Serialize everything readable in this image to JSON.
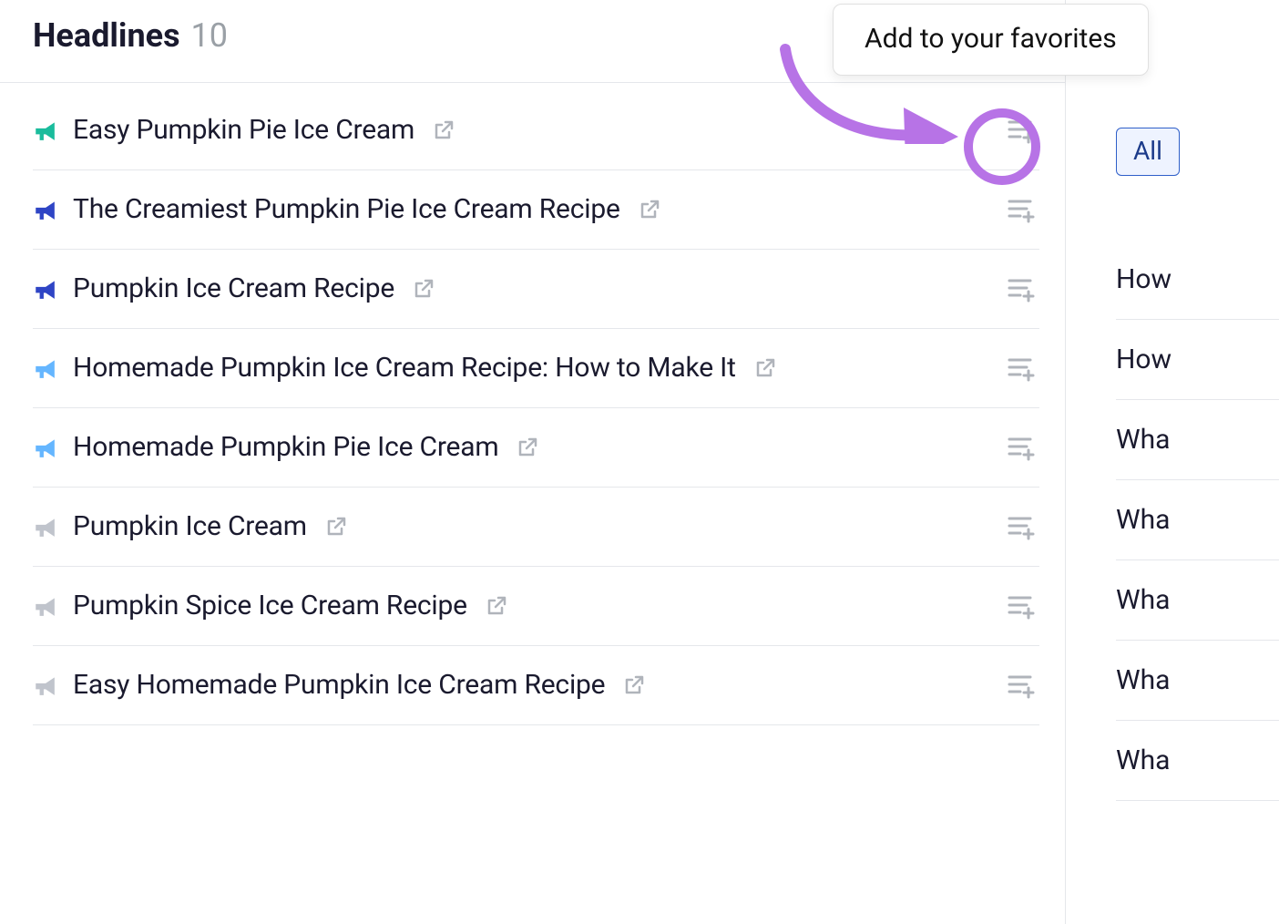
{
  "header": {
    "title": "Headlines",
    "count": "10"
  },
  "tooltip": {
    "text": "Add to your favorites"
  },
  "filter": {
    "all": "All"
  },
  "rows": [
    {
      "id": 0,
      "iconColor": "#1abc9c",
      "title": "Easy Pumpkin Pie Ice Cream"
    },
    {
      "id": 1,
      "iconColor": "#2f45c5",
      "title": "The Creamiest Pumpkin Pie Ice Cream Recipe"
    },
    {
      "id": 2,
      "iconColor": "#2f45c5",
      "title": "Pumpkin Ice Cream Recipe"
    },
    {
      "id": 3,
      "iconColor": "#65b6ff",
      "title": "Homemade Pumpkin Ice Cream Recipe: How to Make It"
    },
    {
      "id": 4,
      "iconColor": "#65b6ff",
      "title": "Homemade Pumpkin Pie Ice Cream"
    },
    {
      "id": 5,
      "iconColor": "#c0c4cc",
      "title": "Pumpkin Ice Cream"
    },
    {
      "id": 6,
      "iconColor": "#c0c4cc",
      "title": "Pumpkin Spice Ice Cream Recipe"
    },
    {
      "id": 7,
      "iconColor": "#c0c4cc",
      "title": "Easy Homemade Pumpkin Ice Cream Recipe"
    }
  ],
  "side": [
    {
      "id": 0,
      "text": "How"
    },
    {
      "id": 1,
      "text": "How"
    },
    {
      "id": 2,
      "text": "Wha"
    },
    {
      "id": 3,
      "text": "Wha"
    },
    {
      "id": 4,
      "text": "Wha"
    },
    {
      "id": 5,
      "text": "Wha"
    },
    {
      "id": 6,
      "text": "Wha"
    }
  ]
}
